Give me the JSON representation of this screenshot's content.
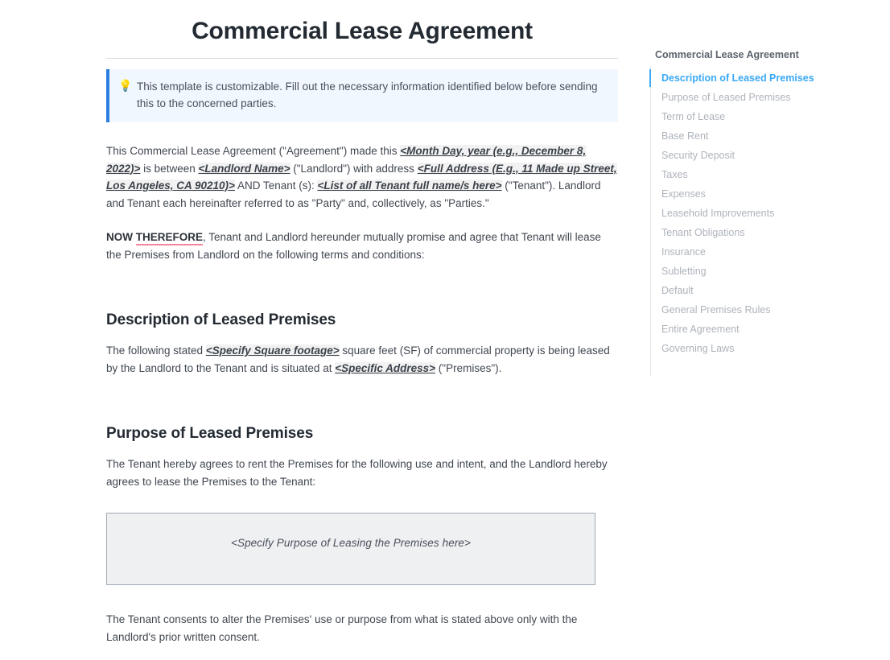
{
  "document": {
    "title": "Commercial Lease Agreement",
    "callout": {
      "icon": "lightbulb-icon",
      "glyph": "Ὂ1",
      "text": "This template is customizable. Fill out the necessary information identified below before sending this to the concerned parties."
    },
    "intro": {
      "seg1": "This Commercial Lease Agreement (\"Agreement\") made this ",
      "ph_date": "<Month Day, year (e.g., December 8, 2022)>",
      "seg2": " is between ",
      "ph_landlord": "<Landlord Name>",
      "seg3": " (\"Landlord\") with address  ",
      "ph_address": "<Full Address (E.g., 11 Made up Street, Los Angeles, CA 90210)>",
      "seg4": " AND Tenant (s): ",
      "ph_tenants": "<List of all Tenant full name/s here>",
      "seg5": " (\"Tenant\"). Landlord and Tenant each hereinafter referred to as \"Party\" and, collectively, as \"Parties.\""
    },
    "now_therefore": {
      "now": "NOW ",
      "therefore": "THEREFORE",
      "rest": ", Tenant and Landlord hereunder mutually promise and agree that Tenant will lease the Premises from Landlord on the following terms and conditions:"
    },
    "sections": [
      {
        "heading": "Description of Leased Premises",
        "body": {
          "seg1": "The following stated ",
          "ph_sqft": "<Specify Square footage>",
          "seg2": " square feet (SF) of commercial property is being leased by the Landlord to the Tenant and is situated at ",
          "ph_addr": "<Specific Address>",
          "seg3": " (\"Premises\")."
        }
      },
      {
        "heading": "Purpose of Leased Premises",
        "body": "The Tenant hereby agrees to rent the Premises for the following use and intent, and the Landlord hereby agrees to lease the Premises to the Tenant:",
        "input_box_placeholder": "<Specify Purpose of Leasing the Premises here>",
        "closing": "The Tenant consents to alter the Premises' use or purpose from what is stated above only with the Landlord's prior written consent."
      }
    ]
  },
  "outline": {
    "title": "Commercial Lease Agreement",
    "active_index": 0,
    "accent_color": "#3ba9f5",
    "items": [
      {
        "label": "Description of Leased Premises"
      },
      {
        "label": "Purpose of Leased Premises"
      },
      {
        "label": "Term of Lease"
      },
      {
        "label": "Base Rent"
      },
      {
        "label": "Security Deposit"
      },
      {
        "label": "Taxes"
      },
      {
        "label": "Expenses"
      },
      {
        "label": "Leasehold Improvements"
      },
      {
        "label": "Tenant Obligations"
      },
      {
        "label": "Insurance"
      },
      {
        "label": "Subletting"
      },
      {
        "label": "Default"
      },
      {
        "label": "General Premises Rules"
      },
      {
        "label": "Entire Agreement"
      },
      {
        "label": "Governing Laws"
      }
    ]
  }
}
